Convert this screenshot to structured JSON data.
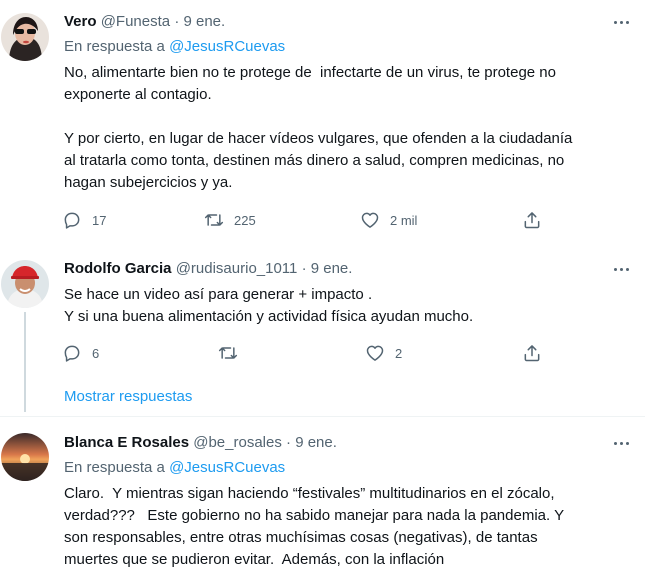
{
  "tweets": [
    {
      "name": "Vero",
      "handle": "@Funesta",
      "dot": "·",
      "date": "9 ene.",
      "reply_prefix": "En respuesta a",
      "reply_mention": "@JesusRCuevas",
      "text": "No, alimentarte bien no te protege de  infectarte de un virus, te protege no\nexponerte al contagio.\n\nY por cierto, en lugar de hacer vídeos vulgares, que ofenden a la ciudadanía\nal tratarla como tonta, destinen más dinero a salud, compren medicinas, no\nhagan subejercicios y ya.",
      "replies": "17",
      "retweets": "225",
      "likes": "2 mil"
    },
    {
      "name": "Rodolfo Garcia",
      "handle": "@rudisaurio_1011",
      "dot": "·",
      "date": "9 ene.",
      "text": "Se hace un video así para generar + impacto .\nY si una buena alimentación y actividad física ayudan mucho.",
      "replies": "6",
      "retweets": "",
      "likes": "2"
    },
    {
      "name": "Blanca E Rosales",
      "handle": "@be_rosales",
      "dot": "·",
      "date": "9 ene.",
      "reply_prefix": "En respuesta a",
      "reply_mention": "@JesusRCuevas",
      "text": "Claro.  Y mientras sigan haciendo “festivales” multitudinarios en el zócalo,\nverdad???   Este gobierno no ha sabido manejar para nada la pandemia. Y\nson responsables, entre otras muchísimas cosas (negativas), de tantas\nmuertes que se pudieron evitar.  Además, con la inflación"
    }
  ],
  "show_more": "Mostrar respuestas",
  "icons": [
    "reply-icon",
    "retweet-icon",
    "like-icon",
    "share-icon",
    "more-icon"
  ],
  "colors": {
    "link": "#1d9bf0",
    "secondary": "#536471",
    "text": "#0f1419"
  }
}
